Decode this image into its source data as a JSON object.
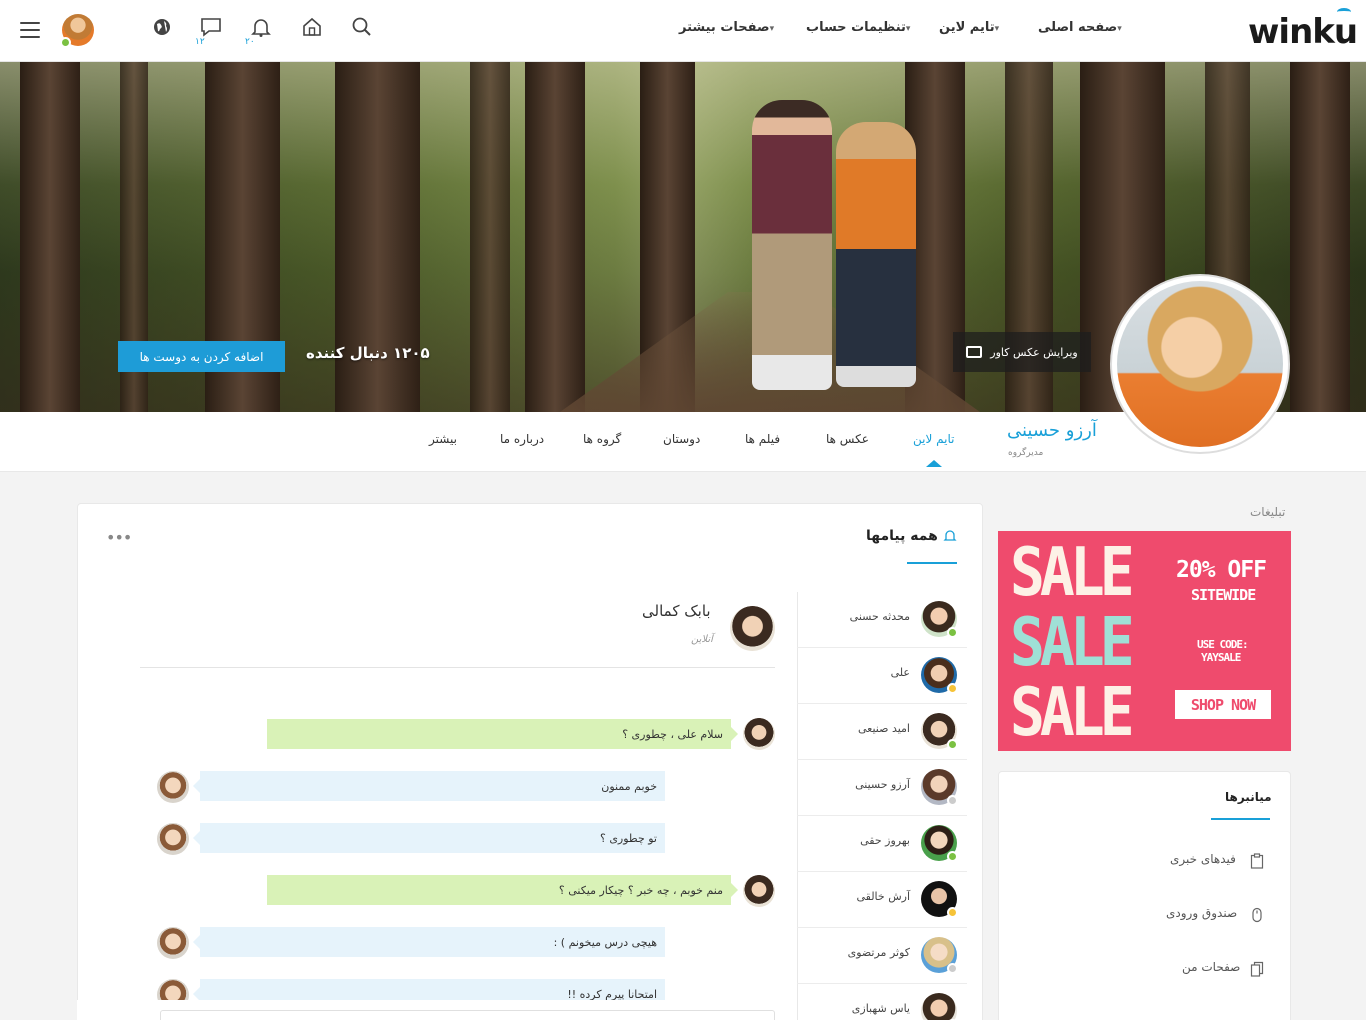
{
  "header": {
    "logo": "winku",
    "menu": [
      {
        "label": "صفحه اصلی"
      },
      {
        "label": "تایم لاین"
      },
      {
        "label": "تنظیمات حساب"
      },
      {
        "label": "صفحات بیشتر"
      }
    ],
    "badges": {
      "messages": "۱۲",
      "notifications": "۲۰"
    },
    "icons": [
      "search-icon",
      "home-icon",
      "bell-icon",
      "chat-icon",
      "globe-icon",
      "menu-icon"
    ]
  },
  "cover": {
    "edit_cover_label": "ویرایش عکس کاور",
    "followers_label": "۱۲۰۵ دنبال کننده",
    "add_friend_label": "اضافه کردن به دوست ها"
  },
  "profile": {
    "name": "آرزو حسینی",
    "role": "مدیرگروه",
    "tabs": [
      {
        "label": "تایم لاین",
        "active": true
      },
      {
        "label": "عکس ها"
      },
      {
        "label": "فیلم ها"
      },
      {
        "label": "دوستان"
      },
      {
        "label": "گروه ها"
      },
      {
        "label": "درباره ما"
      },
      {
        "label": "بیشتر"
      }
    ]
  },
  "messages": {
    "title": "همه پیامها",
    "contacts": [
      {
        "name": "محدثه حسنی",
        "status": "online"
      },
      {
        "name": "علی",
        "status": "away"
      },
      {
        "name": "امید صنیعی",
        "status": "online"
      },
      {
        "name": "آرزو حسینی",
        "status": "offline"
      },
      {
        "name": "بهروز حقی",
        "status": "online"
      },
      {
        "name": "آرش خالقی",
        "status": "away"
      },
      {
        "name": "کوثر مرتضوی",
        "status": "offline"
      },
      {
        "name": "یاس شهبازی",
        "status": "online"
      }
    ],
    "chat": {
      "name": "بابک کمالی",
      "status": "آنلاین",
      "messages": [
        {
          "text": "سلام علی ، چطوری ؟",
          "dir": "out"
        },
        {
          "text": "خوبم ممنون",
          "dir": "in"
        },
        {
          "text": "تو چطوری ؟",
          "dir": "in"
        },
        {
          "text": "منم خوبم ، چه خبر ؟ چیکار میکنی ؟",
          "dir": "out"
        },
        {
          "text": "هیچی درس میخونم ) :",
          "dir": "in"
        },
        {
          "text": "امتحانا پیرم کرده !!",
          "dir": "in"
        }
      ]
    }
  },
  "sidebar": {
    "ads_label": "تبلیغات",
    "ad": {
      "sale": "SALE",
      "off": "20% OFF",
      "sitewide": "SITEWIDE",
      "code_line1": "USE CODE:",
      "code_line2": "YAYSALE",
      "shop": "SHOP NOW"
    },
    "shortcuts_title": "میانبرها",
    "shortcuts": [
      {
        "label": "فیدهای خبری",
        "icon": "clipboard-icon"
      },
      {
        "label": "صندوق ورودی",
        "icon": "mouse-icon"
      },
      {
        "label": "صفحات من",
        "icon": "files-icon"
      }
    ]
  },
  "colors": {
    "accent": "#1e9cd7",
    "online": "#7bc142",
    "away": "#f6c338",
    "offline": "#cccccc",
    "ad": "#ef4b6d"
  }
}
